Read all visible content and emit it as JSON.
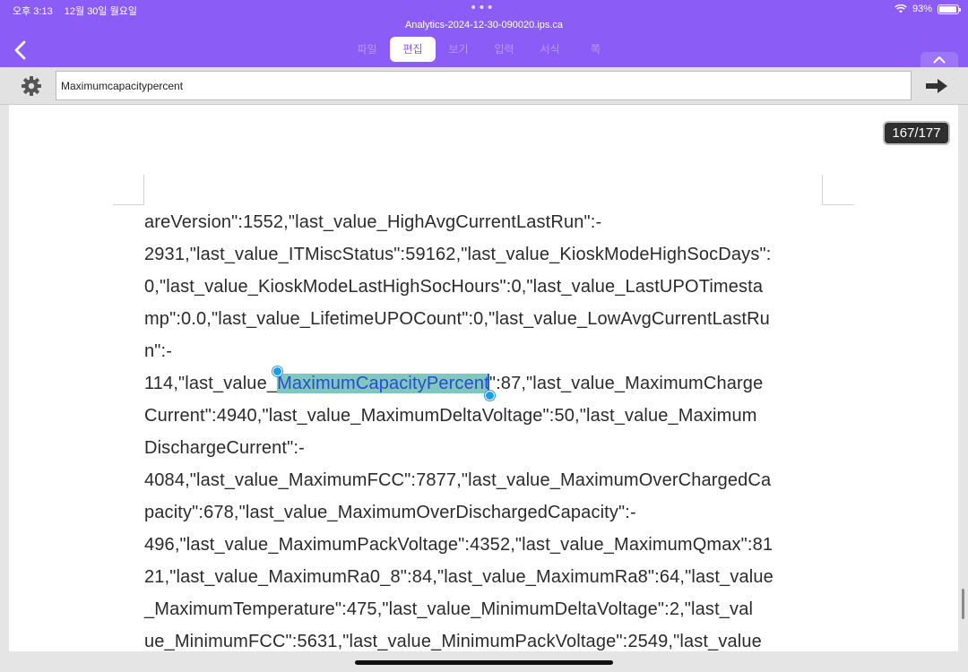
{
  "status_bar": {
    "time": "오후 3:13",
    "date": "12월 30일 월요일",
    "dots": "•••",
    "battery_text": "93%",
    "battery_level": 0.93
  },
  "window_title": "Analytics-2024-12-30-090020.ips.ca",
  "tabs": [
    {
      "label": "파일"
    },
    {
      "label": "편집"
    },
    {
      "label": "보기"
    },
    {
      "label": "입력"
    },
    {
      "label": "서식"
    },
    {
      "label": "쪽"
    }
  ],
  "active_tab": "편집",
  "search": {
    "value": "Maximumcapacitypercent",
    "placeholder": ""
  },
  "match_counter": "167/177",
  "document": {
    "lines": [
      "areVersion\":1552,\"last_value_HighAvgCurrentLastRun\":-",
      "2931,\"last_value_ITMiscStatus\":59162,\"last_value_KioskModeHighSocDays\":",
      "0,\"last_value_KioskModeLastHighSocHours\":0,\"last_value_LastUPOTimesta",
      "mp\":0.0,\"last_value_LifetimeUPOCount\":0,\"last_value_LowAvgCurrentLastRu",
      "n\":-"
    ],
    "highlight_line": {
      "before": "114,\"last_value_",
      "match": "MaximumCapacityPercent",
      "after": "\":87,\"last_value_MaximumCharge"
    },
    "lines_after": [
      "Current\":4940,\"last_value_MaximumDeltaVoltage\":50,\"last_value_Maximum",
      "DischargeCurrent\":-",
      "4084,\"last_value_MaximumFCC\":7877,\"last_value_MaximumOverChargedCa",
      "pacity\":678,\"last_value_MaximumOverDischargedCapacity\":-",
      "496,\"last_value_MaximumPackVoltage\":4352,\"last_value_MaximumQmax\":81",
      "21,\"last_value_MaximumRa0_8\":84,\"last_value_MaximumRa8\":64,\"last_value",
      "_MaximumTemperature\":475,\"last_value_MinimumDeltaVoltage\":2,\"last_val",
      "ue_MinimumFCC\":5631,\"last_value_MinimumPackVoltage\":2549,\"last_value"
    ]
  },
  "icons": {
    "back": "chevron-left-icon",
    "settings": "gear-icon",
    "go": "arrow-right-icon",
    "collapse": "chevron-up-icon",
    "wifi": "wifi-icon",
    "battery": "battery-icon"
  },
  "colors": {
    "accent": "#8b5cf6",
    "highlight": "#7fc7c0",
    "selection_handle": "#1e9be8"
  }
}
